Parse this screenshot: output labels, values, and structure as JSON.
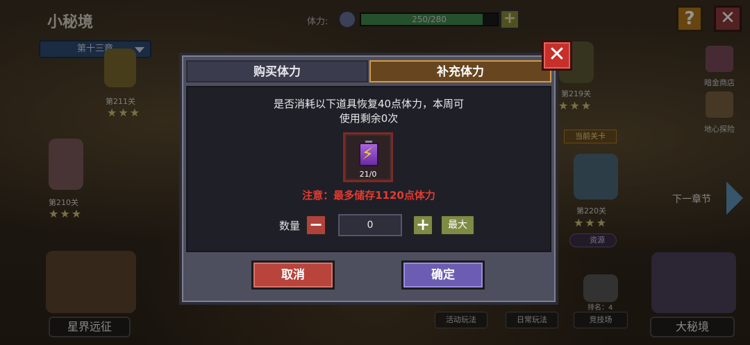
{
  "header": {
    "title": "小秘境",
    "chapter": "第十三章",
    "stamina_label": "体力:",
    "stamina_text": "250/280",
    "stamina_current": 250,
    "stamina_max": 280,
    "stamina_plus": "+",
    "help": "?",
    "close": "✕"
  },
  "map": {
    "stages": [
      {
        "label": "第211关",
        "stars": "★★★"
      },
      {
        "label": "第210关",
        "stars": "★★★"
      },
      {
        "label": "第219关",
        "stars": "★★★"
      },
      {
        "label": "第220关",
        "stars": "★★★"
      }
    ],
    "current_stage_badge": "当前关卡",
    "next_chapter": "下一章节",
    "resource_badge": "资源"
  },
  "side_menu": {
    "shop": "暗金商店",
    "explore": "地心探险"
  },
  "bottom": {
    "astral": "星界远征",
    "activity": "活动玩法",
    "daily": "日常玩法",
    "arena": "竞技场",
    "rank": "排名：4",
    "big_realm": "大秘境"
  },
  "modal": {
    "tab_buy": "购买体力",
    "tab_refill": "补充体力",
    "desc_line1": "是否消耗以下道具恢复40点体力，本周可",
    "desc_line2": "使用剩余0次",
    "item_count": "21/0",
    "warning": "注意：最多储存1120点体力",
    "qty_label": "数量",
    "qty_minus": "−",
    "qty_value": "0",
    "qty_plus": "+",
    "qty_max": "最大",
    "cancel": "取消",
    "confirm": "确定",
    "close": "✕"
  },
  "colors": {
    "cancel": "#b8443c",
    "confirm": "#6c5db3",
    "warning": "#e43a2e",
    "active_tab_border": "#d59a45"
  }
}
